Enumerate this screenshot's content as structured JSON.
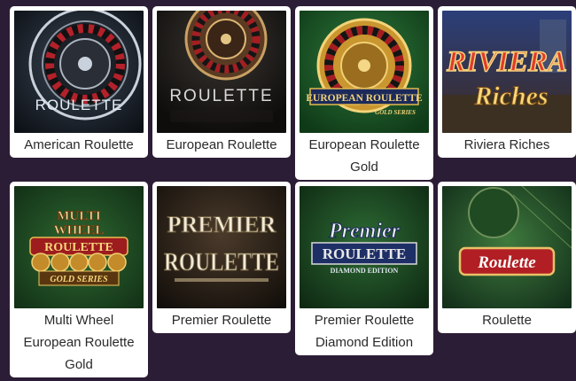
{
  "games": [
    {
      "title": "American Roulette",
      "art_text": "ROULETTE"
    },
    {
      "title": "European Roulette",
      "art_text": "ROULETTE"
    },
    {
      "title": "European Roulette Gold",
      "art_text": "EUROPEAN ROULETTE",
      "art_sub": "GOLD SERIES"
    },
    {
      "title": "Riviera Riches",
      "art_line1": "RIVIERA",
      "art_line2": "Riches"
    },
    {
      "title": "Multi Wheel European Roulette Gold",
      "art_line1": "MULTI",
      "art_line2": "WHEEL",
      "art_line3": "ROULETTE",
      "art_sub": "GOLD SERIES"
    },
    {
      "title": "Premier Roulette",
      "art_line1": "PREMIER",
      "art_line2": "ROULETTE"
    },
    {
      "title": "Premier Roulette Diamond Edition",
      "art_line1": "Premier",
      "art_line2": "ROULETTE",
      "art_sub": "DIAMOND EDITION"
    },
    {
      "title": "Roulette",
      "art_text": "Roulette"
    }
  ],
  "colors": {
    "page_background": "#2c1d36",
    "card_background": "#ffffff",
    "label_text": "#2a2a2a"
  },
  "icons": {
    "roulette_wheel": "roulette-wheel-icon"
  }
}
